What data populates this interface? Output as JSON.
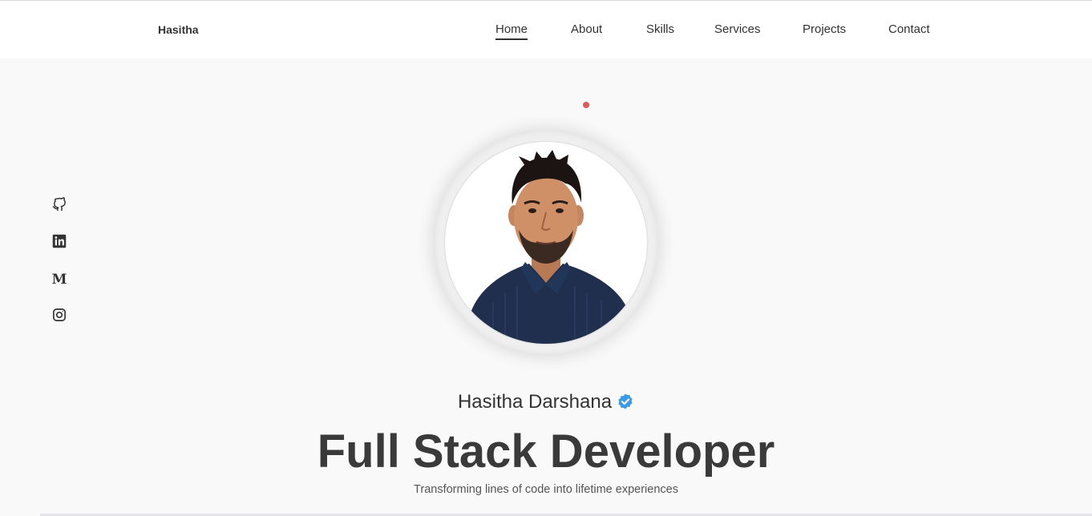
{
  "header": {
    "logo": "Hasitha",
    "nav": [
      {
        "label": "Home",
        "active": true
      },
      {
        "label": "About",
        "active": false
      },
      {
        "label": "Skills",
        "active": false
      },
      {
        "label": "Services",
        "active": false
      },
      {
        "label": "Projects",
        "active": false
      },
      {
        "label": "Contact",
        "active": false
      }
    ]
  },
  "socials": [
    "github-icon",
    "linkedin-icon",
    "medium-icon",
    "instagram-icon"
  ],
  "hero": {
    "name": "Hasitha Darshana",
    "verified_color": "#3b9ae8",
    "title": "Full Stack Developer",
    "tagline": "Transforming lines of code into lifetime experiences"
  },
  "colors": {
    "accent_dot": "#e05a5a",
    "text": "#333333"
  }
}
